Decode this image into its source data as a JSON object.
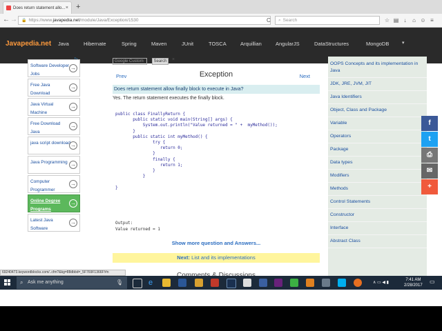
{
  "browser": {
    "tab_title": "Does return statement allo...",
    "tab_close": "×",
    "new_tab": "+",
    "url_prefix": "https://www.",
    "url_domain": "javapedia.net",
    "url_path": "/module/Java/Exception/1530",
    "search_placeholder": "Search",
    "back": "←",
    "forward": "→",
    "lock": "🔒",
    "reload": "C"
  },
  "site": {
    "logo": "Javapedia.net",
    "nav": [
      "Java",
      "Hibernate",
      "Spring",
      "Maven",
      "JUnit",
      "TOSCA",
      "Arquillian",
      "AngularJS",
      "DataStructures",
      "MongoDB"
    ],
    "nav_dropdown": "▾"
  },
  "google": {
    "placeholder": "Google  Custom",
    "button": "Search",
    "clear": "×"
  },
  "ads": {
    "info": "▷",
    "items": [
      {
        "label": "Software Developer Jobs",
        "highlight": false
      },
      {
        "label": "Free Java Download",
        "highlight": false
      },
      {
        "label": "Java Virtual Machine",
        "highlight": false
      },
      {
        "label": "Free Download Java",
        "highlight": false
      },
      {
        "label": "java script download",
        "highlight": false
      },
      {
        "label": "Java Programming",
        "highlight": false
      },
      {
        "label": "Computer Programmer",
        "highlight": false
      },
      {
        "label": "Online Degree Programs",
        "highlight": true
      },
      {
        "label": "Latest Java Software",
        "highlight": false
      }
    ],
    "arrow": "→"
  },
  "main": {
    "prev": "Prev",
    "title": "Exception",
    "next": "Next",
    "question": "Does return statement allow finally block to execute in Java?",
    "answer": "Yes. The return statement executes the finally block.",
    "code": [
      "public class FinallyReturn {",
      "       public static void main(String[] args) {",
      "           System.out.println(\"Value returned = \" +  myMethod());",
      "       }",
      "       public static int myMethod() {",
      "               try {",
      "                  return 0;",
      "               }",
      "               finally {",
      "                  return 1;",
      "               }",
      "           }",
      "",
      "}"
    ],
    "output_label": "Output:",
    "output_value": "Value returned = 1",
    "show_more": "Show more question and Answers...",
    "next_bar_prefix": "Next:",
    "next_bar_link": "List and its implementations",
    "comments_heading": "Comments & Discussions"
  },
  "sidebar": {
    "items": [
      "OOPS Concepts and its implementation in Java",
      "JDK, JRE, JVM, JIT",
      "Java Identifiers",
      "Object, Class and Package",
      "Variable",
      "Operators",
      "Package",
      "Data types",
      "Modifiers",
      "Methods",
      "Control Statements",
      "Constructor",
      "Interface",
      "Abstract Class"
    ]
  },
  "share": {
    "facebook": "f",
    "twitter": "t",
    "print": "⎙",
    "email": "✉",
    "more": "+"
  },
  "status_url": "69240473.keywordblocks.com/..cfm?&kg=88dbbd=_5F769F1366F!#n",
  "taskbar": {
    "search_text": "Ask me anything",
    "time": "7:41 AM",
    "date": "2/28/2017"
  },
  "colors": {
    "header_bg": "#2a2a2a",
    "logo": "#ff9a3c",
    "link": "#2a6cc0",
    "question_bg": "#d9eef0",
    "next_bar_bg": "#fff59d",
    "sidebar_bg": "#e4ebe4",
    "ad_highlight": "#5cb85c",
    "facebook": "#3b5998",
    "twitter": "#1da1f2",
    "print": "#777777",
    "email": "#666666",
    "more": "#f05a3c"
  }
}
